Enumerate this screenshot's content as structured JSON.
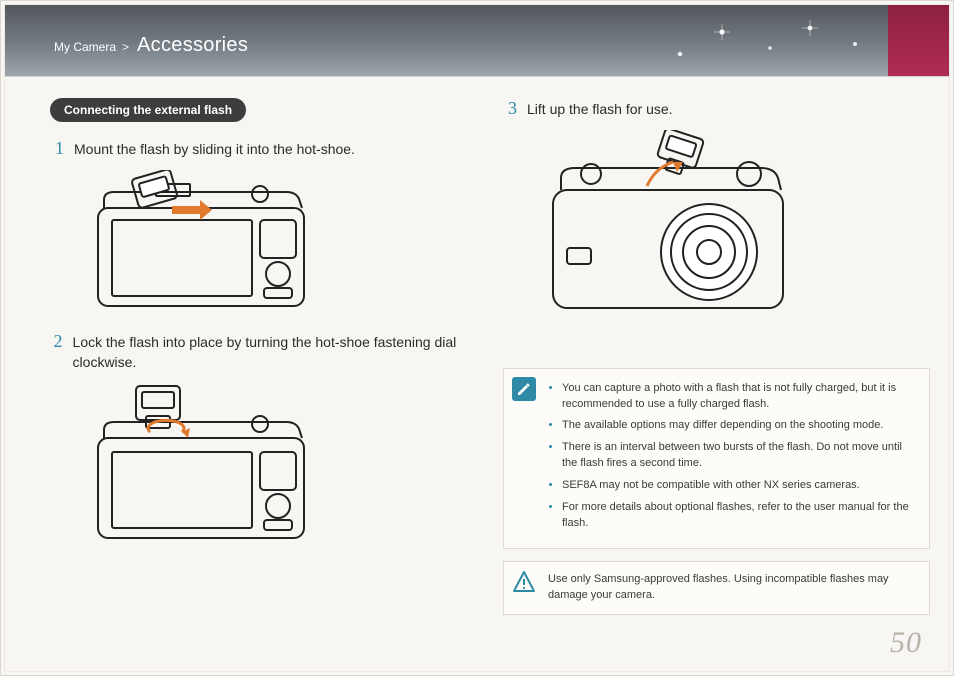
{
  "header": {
    "section": "My Camera",
    "separator": ">",
    "page_title": "Accessories"
  },
  "left": {
    "subheading": "Connecting the external flash",
    "step1_num": "1",
    "step1_text": "Mount the flash by sliding it into the hot-shoe.",
    "step2_num": "2",
    "step2_text": "Lock the flash into place by turning the hot-shoe fastening dial clockwise."
  },
  "right": {
    "step3_num": "3",
    "step3_text": "Lift up the flash for use.",
    "tips": [
      "You can capture a photo with a flash that is not fully charged, but it is recommended to use a fully charged flash.",
      "The available options may differ depending on the shooting mode.",
      "There is an interval between two bursts of the flash. Do not move until the flash fires a second time.",
      "SEF8A may not be compatible with other NX series cameras.",
      "For more details about optional flashes, refer to the user manual for the flash."
    ],
    "warning": "Use only Samsung-approved flashes. Using incompatible flashes may damage your camera."
  },
  "page_number": "50",
  "icons": {
    "tips_icon": "edit-note-icon",
    "warning_icon": "warning-icon"
  }
}
